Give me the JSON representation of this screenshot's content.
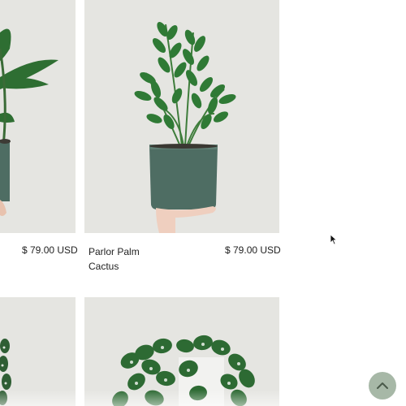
{
  "products": [
    {
      "name": "",
      "price": "$ 79.00 USD"
    },
    {
      "name": "Parlor Palm",
      "category": "Cactus",
      "price": "$ 79.00 USD"
    }
  ],
  "scroll_top": {
    "icon": "chevron-up-icon",
    "color": "#a7b8a7"
  },
  "colors": {
    "tile_background": "#e5e5e1",
    "pot_green": "#4e6d63",
    "leaf_green": "#2f7a35"
  }
}
